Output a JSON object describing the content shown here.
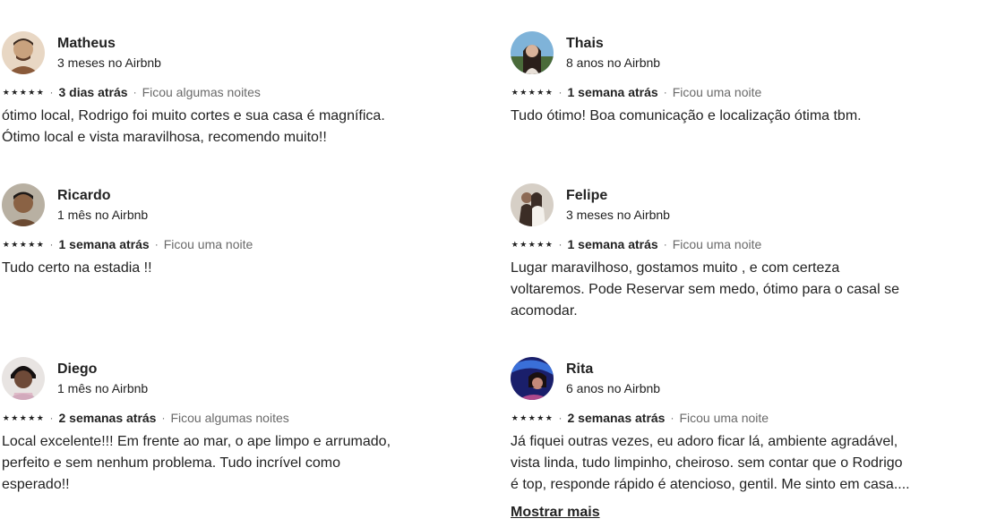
{
  "reviews": [
    {
      "name": "Matheus",
      "tenure": "3 meses no Airbnb",
      "stars": 5,
      "date": "3 dias atrás",
      "stay": "Ficou algumas noites",
      "text": "ótimo local, Rodrigo foi muito cortes e sua casa é magnífica.\nÓtimo local e vista maravilhosa, recomendo muito!!",
      "avatar_icon": "user-photo-icon",
      "avatar_colors": [
        "#c9a27e",
        "#8a5a3a",
        "#3a2a20"
      ]
    },
    {
      "name": "Thais",
      "tenure": "8 anos no Airbnb",
      "stars": 5,
      "date": "1 semana atrás",
      "stay": "Ficou uma noite",
      "text": "Tudo ótimo! Boa comunicação e localização ótima tbm.",
      "avatar_icon": "user-photo-icon",
      "avatar_colors": [
        "#7fb3d9",
        "#4a6b3a",
        "#2a1f1a"
      ]
    },
    {
      "name": "Ricardo",
      "tenure": "1 mês no Airbnb",
      "stars": 5,
      "date": "1 semana atrás",
      "stay": "Ficou uma noite",
      "text": "Tudo certo na estadia !!",
      "avatar_icon": "user-photo-icon",
      "avatar_colors": [
        "#b8b0a2",
        "#6b4a32",
        "#1e1a18"
      ]
    },
    {
      "name": "Felipe",
      "tenure": "3 meses no Airbnb",
      "stars": 5,
      "date": "1 semana atrás",
      "stay": "Ficou uma noite",
      "text": "Lugar maravilhoso, gostamos muito , e com certeza\nvoltaremos. Pode Reservar sem medo, ótimo para o casal se\nacomodar.",
      "avatar_icon": "user-photo-icon",
      "avatar_colors": [
        "#d6cfc6",
        "#8c6a55",
        "#3b2d26"
      ]
    },
    {
      "name": "Diego",
      "tenure": "1 mês no Airbnb",
      "stars": 5,
      "date": "2 semanas atrás",
      "stay": "Ficou algumas noites",
      "text": "Local excelente!!! Em frente ao mar, o ape limpo e arrumado,\nperfeito e sem nenhum problema. Tudo incrível como\nesperado!!",
      "avatar_icon": "user-photo-icon",
      "avatar_colors": [
        "#e8e4e2",
        "#6e4a38",
        "#141010"
      ]
    },
    {
      "name": "Rita",
      "tenure": "6 anos no Airbnb",
      "stars": 5,
      "date": "2 semanas atrás",
      "stay": "Ficou uma noite",
      "text": "Já fiquei outras vezes, eu adoro ficar lá, ambiente agradável,\nvista linda, tudo limpinho, cheiroso. sem contar que o Rodrigo\né top, responde rápido é atencioso, gentil. Me sinto em casa....",
      "avatar_icon": "user-photo-icon",
      "avatar_colors": [
        "#1a1f6b",
        "#3a6fd8",
        "#b04a8c"
      ]
    }
  ],
  "show_more_label": "Mostrar mais",
  "star_glyph": "★",
  "separator": "·"
}
